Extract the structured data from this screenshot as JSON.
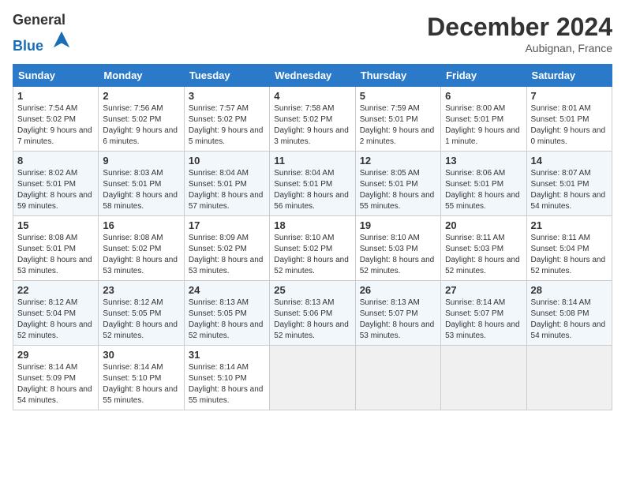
{
  "header": {
    "logo_line1": "General",
    "logo_line2": "Blue",
    "month": "December 2024",
    "location": "Aubignan, France"
  },
  "weekdays": [
    "Sunday",
    "Monday",
    "Tuesday",
    "Wednesday",
    "Thursday",
    "Friday",
    "Saturday"
  ],
  "weeks": [
    [
      {
        "day": "1",
        "sr": "Sunrise: 7:54 AM",
        "ss": "Sunset: 5:02 PM",
        "dl": "Daylight: 9 hours and 7 minutes."
      },
      {
        "day": "2",
        "sr": "Sunrise: 7:56 AM",
        "ss": "Sunset: 5:02 PM",
        "dl": "Daylight: 9 hours and 6 minutes."
      },
      {
        "day": "3",
        "sr": "Sunrise: 7:57 AM",
        "ss": "Sunset: 5:02 PM",
        "dl": "Daylight: 9 hours and 5 minutes."
      },
      {
        "day": "4",
        "sr": "Sunrise: 7:58 AM",
        "ss": "Sunset: 5:02 PM",
        "dl": "Daylight: 9 hours and 3 minutes."
      },
      {
        "day": "5",
        "sr": "Sunrise: 7:59 AM",
        "ss": "Sunset: 5:01 PM",
        "dl": "Daylight: 9 hours and 2 minutes."
      },
      {
        "day": "6",
        "sr": "Sunrise: 8:00 AM",
        "ss": "Sunset: 5:01 PM",
        "dl": "Daylight: 9 hours and 1 minute."
      },
      {
        "day": "7",
        "sr": "Sunrise: 8:01 AM",
        "ss": "Sunset: 5:01 PM",
        "dl": "Daylight: 9 hours and 0 minutes."
      }
    ],
    [
      {
        "day": "8",
        "sr": "Sunrise: 8:02 AM",
        "ss": "Sunset: 5:01 PM",
        "dl": "Daylight: 8 hours and 59 minutes."
      },
      {
        "day": "9",
        "sr": "Sunrise: 8:03 AM",
        "ss": "Sunset: 5:01 PM",
        "dl": "Daylight: 8 hours and 58 minutes."
      },
      {
        "day": "10",
        "sr": "Sunrise: 8:04 AM",
        "ss": "Sunset: 5:01 PM",
        "dl": "Daylight: 8 hours and 57 minutes."
      },
      {
        "day": "11",
        "sr": "Sunrise: 8:04 AM",
        "ss": "Sunset: 5:01 PM",
        "dl": "Daylight: 8 hours and 56 minutes."
      },
      {
        "day": "12",
        "sr": "Sunrise: 8:05 AM",
        "ss": "Sunset: 5:01 PM",
        "dl": "Daylight: 8 hours and 55 minutes."
      },
      {
        "day": "13",
        "sr": "Sunrise: 8:06 AM",
        "ss": "Sunset: 5:01 PM",
        "dl": "Daylight: 8 hours and 55 minutes."
      },
      {
        "day": "14",
        "sr": "Sunrise: 8:07 AM",
        "ss": "Sunset: 5:01 PM",
        "dl": "Daylight: 8 hours and 54 minutes."
      }
    ],
    [
      {
        "day": "15",
        "sr": "Sunrise: 8:08 AM",
        "ss": "Sunset: 5:01 PM",
        "dl": "Daylight: 8 hours and 53 minutes."
      },
      {
        "day": "16",
        "sr": "Sunrise: 8:08 AM",
        "ss": "Sunset: 5:02 PM",
        "dl": "Daylight: 8 hours and 53 minutes."
      },
      {
        "day": "17",
        "sr": "Sunrise: 8:09 AM",
        "ss": "Sunset: 5:02 PM",
        "dl": "Daylight: 8 hours and 53 minutes."
      },
      {
        "day": "18",
        "sr": "Sunrise: 8:10 AM",
        "ss": "Sunset: 5:02 PM",
        "dl": "Daylight: 8 hours and 52 minutes."
      },
      {
        "day": "19",
        "sr": "Sunrise: 8:10 AM",
        "ss": "Sunset: 5:03 PM",
        "dl": "Daylight: 8 hours and 52 minutes."
      },
      {
        "day": "20",
        "sr": "Sunrise: 8:11 AM",
        "ss": "Sunset: 5:03 PM",
        "dl": "Daylight: 8 hours and 52 minutes."
      },
      {
        "day": "21",
        "sr": "Sunrise: 8:11 AM",
        "ss": "Sunset: 5:04 PM",
        "dl": "Daylight: 8 hours and 52 minutes."
      }
    ],
    [
      {
        "day": "22",
        "sr": "Sunrise: 8:12 AM",
        "ss": "Sunset: 5:04 PM",
        "dl": "Daylight: 8 hours and 52 minutes."
      },
      {
        "day": "23",
        "sr": "Sunrise: 8:12 AM",
        "ss": "Sunset: 5:05 PM",
        "dl": "Daylight: 8 hours and 52 minutes."
      },
      {
        "day": "24",
        "sr": "Sunrise: 8:13 AM",
        "ss": "Sunset: 5:05 PM",
        "dl": "Daylight: 8 hours and 52 minutes."
      },
      {
        "day": "25",
        "sr": "Sunrise: 8:13 AM",
        "ss": "Sunset: 5:06 PM",
        "dl": "Daylight: 8 hours and 52 minutes."
      },
      {
        "day": "26",
        "sr": "Sunrise: 8:13 AM",
        "ss": "Sunset: 5:07 PM",
        "dl": "Daylight: 8 hours and 53 minutes."
      },
      {
        "day": "27",
        "sr": "Sunrise: 8:14 AM",
        "ss": "Sunset: 5:07 PM",
        "dl": "Daylight: 8 hours and 53 minutes."
      },
      {
        "day": "28",
        "sr": "Sunrise: 8:14 AM",
        "ss": "Sunset: 5:08 PM",
        "dl": "Daylight: 8 hours and 54 minutes."
      }
    ],
    [
      {
        "day": "29",
        "sr": "Sunrise: 8:14 AM",
        "ss": "Sunset: 5:09 PM",
        "dl": "Daylight: 8 hours and 54 minutes."
      },
      {
        "day": "30",
        "sr": "Sunrise: 8:14 AM",
        "ss": "Sunset: 5:10 PM",
        "dl": "Daylight: 8 hours and 55 minutes."
      },
      {
        "day": "31",
        "sr": "Sunrise: 8:14 AM",
        "ss": "Sunset: 5:10 PM",
        "dl": "Daylight: 8 hours and 55 minutes."
      },
      null,
      null,
      null,
      null
    ]
  ]
}
